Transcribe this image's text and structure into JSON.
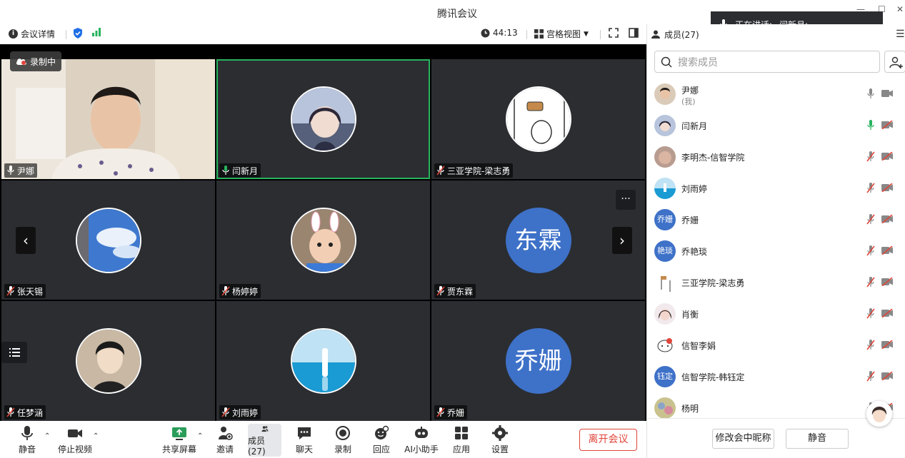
{
  "window": {
    "title": "腾讯会议"
  },
  "infobar": {
    "meeting_details": "会议详情",
    "timer": "44:13",
    "view_mode": "宫格视图"
  },
  "panel": {
    "tab_members": "成员(27)",
    "search_placeholder": "搜索成员",
    "members": [
      {
        "name": "尹娜",
        "sub": "(我)",
        "avatar_text": "",
        "mic": "on",
        "cam": "on"
      },
      {
        "name": "闫新月",
        "sub": "",
        "avatar_text": "",
        "mic": "speaking",
        "cam": "off"
      },
      {
        "name": "李明杰-信智学院",
        "sub": "",
        "avatar_text": "",
        "mic": "muted",
        "cam": "off"
      },
      {
        "name": "刘雨婷",
        "sub": "",
        "avatar_text": "",
        "mic": "muted",
        "cam": "off"
      },
      {
        "name": "乔姗",
        "sub": "",
        "avatar_text": "乔姗",
        "mic": "muted",
        "cam": "off"
      },
      {
        "name": "乔艳琰",
        "sub": "",
        "avatar_text": "艳琰",
        "mic": "muted",
        "cam": "off"
      },
      {
        "name": "三亚学院-梁志勇",
        "sub": "",
        "avatar_text": "",
        "mic": "muted",
        "cam": "off"
      },
      {
        "name": "肖衡",
        "sub": "",
        "avatar_text": "",
        "mic": "muted",
        "cam": "off"
      },
      {
        "name": "信智李娟",
        "sub": "",
        "avatar_text": "",
        "mic": "muted",
        "cam": "off"
      },
      {
        "name": "信智学院-韩钰定",
        "sub": "",
        "avatar_text": "钰定",
        "mic": "muted",
        "cam": "off"
      },
      {
        "name": "杨明",
        "sub": "",
        "avatar_text": "",
        "mic": "muted",
        "cam": "off"
      }
    ],
    "rename_button": "修改会中昵称",
    "mute_button": "静音"
  },
  "toast": {
    "label": "正在讲话:",
    "speaker": "闫新月;"
  },
  "recording": "录制中",
  "tiles": [
    {
      "name": "尹娜",
      "avatar_text": ""
    },
    {
      "name": "闫新月",
      "avatar_text": ""
    },
    {
      "name": "三亚学院-梁志勇",
      "avatar_text": ""
    },
    {
      "name": "张天锡",
      "avatar_text": ""
    },
    {
      "name": "杨婷婷",
      "avatar_text": ""
    },
    {
      "name": "贾东霖",
      "avatar_text": "东霖"
    },
    {
      "name": "任梦涵",
      "avatar_text": ""
    },
    {
      "name": "刘雨婷",
      "avatar_text": ""
    },
    {
      "name": "乔姗",
      "avatar_text": "乔姗"
    }
  ],
  "toolbar": {
    "mute": "静音",
    "stop_video": "停止视频",
    "share_screen": "共享屏幕",
    "invite": "邀请",
    "members": "成员(27)",
    "chat": "聊天",
    "record": "录制",
    "react": "回应",
    "ai_assistant": "AI小助手",
    "apps": "应用",
    "settings": "设置",
    "leave": "离开会议"
  },
  "colors": {
    "accent_blue": "#3e71c8",
    "active_green": "#27b35e",
    "danger_red": "#e0453a"
  }
}
